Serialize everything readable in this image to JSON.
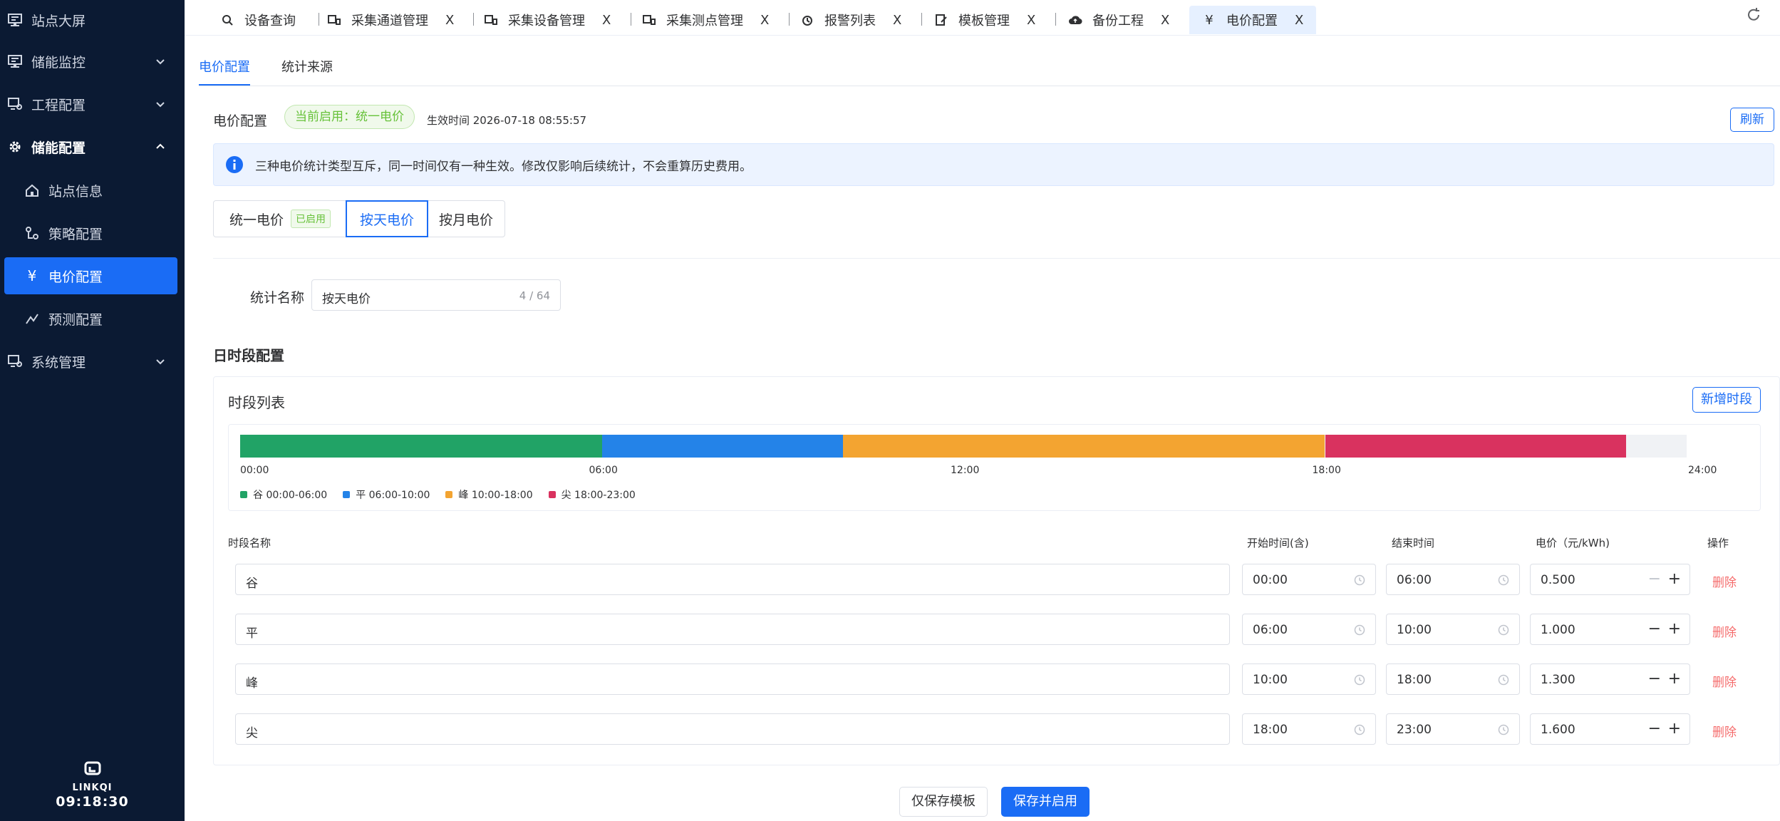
{
  "sidebar": {
    "items": [
      {
        "label": "站点大屏"
      },
      {
        "label": "储能监控"
      },
      {
        "label": "工程配置"
      },
      {
        "label": "储能配置"
      },
      {
        "label": "站点信息"
      },
      {
        "label": "策略配置"
      },
      {
        "label": "电价配置"
      },
      {
        "label": "预测配置"
      },
      {
        "label": "系统管理"
      }
    ],
    "brand": "LINKQI",
    "clock": "09:18:30"
  },
  "tabs": [
    {
      "label": "设备查询"
    },
    {
      "label": "采集通道管理",
      "close": "X"
    },
    {
      "label": "采集设备管理",
      "close": "X"
    },
    {
      "label": "采集测点管理",
      "close": "X"
    },
    {
      "label": "报警列表",
      "close": "X"
    },
    {
      "label": "模板管理",
      "close": "X"
    },
    {
      "label": "备份工程",
      "close": "X"
    },
    {
      "label": "电价配置",
      "close": "X"
    }
  ],
  "subtabs": [
    "电价配置",
    "统计来源"
  ],
  "header": {
    "title": "电价配置",
    "status_tag": "当前启用：统一电价",
    "effective_time": "生效时间 2026-07-18 08:55:57",
    "refresh": "刷新"
  },
  "alert": "三种电价统计类型互斥，同一时间仅有一种生效。修改仅影响后续统计，不会重算历史费用。",
  "segments": {
    "unified": "统一电价",
    "enabled_tag": "已启用",
    "daily": "按天电价",
    "monthly": "按月电价"
  },
  "form": {
    "name_label": "统计名称",
    "name_value": "按天电价",
    "name_count": "4 / 64"
  },
  "section_title": "日时段配置",
  "card": {
    "title": "时段列表",
    "add_button": "新增时段"
  },
  "chart_data": {
    "type": "bar",
    "x_range": [
      0,
      24
    ],
    "ticks": [
      "00:00",
      "06:00",
      "12:00",
      "18:00",
      "24:00"
    ],
    "series": [
      {
        "name": "谷 00:00-06:00",
        "start": 0,
        "end": 6,
        "color": "#21a366"
      },
      {
        "name": "平 06:00-10:00",
        "start": 6,
        "end": 10,
        "color": "#2483e8"
      },
      {
        "name": "峰 10:00-18:00",
        "start": 10,
        "end": 18,
        "color": "#f3a431"
      },
      {
        "name": "尖 18:00-23:00",
        "start": 18,
        "end": 23,
        "color": "#d9325f"
      }
    ]
  },
  "table": {
    "headers": [
      "时段名称",
      "开始时间(含)",
      "结束时间",
      "电价（元/kWh)",
      "操作"
    ],
    "rows": [
      {
        "name": "谷",
        "start": "00:00",
        "end": "06:00",
        "price": "0.500",
        "action": "删除"
      },
      {
        "name": "平",
        "start": "06:00",
        "end": "10:00",
        "price": "1.000",
        "action": "删除"
      },
      {
        "name": "峰",
        "start": "10:00",
        "end": "18:00",
        "price": "1.300",
        "action": "删除"
      },
      {
        "name": "尖",
        "start": "18:00",
        "end": "23:00",
        "price": "1.600",
        "action": "删除"
      }
    ]
  },
  "footer": {
    "save_template": "仅保存模板",
    "save_enable": "保存并启用"
  },
  "colors": {
    "primary": "#1a6cf5",
    "sidebar_bg": "#0b1a33",
    "danger": "#f56c6c",
    "success": "#67c23a"
  }
}
